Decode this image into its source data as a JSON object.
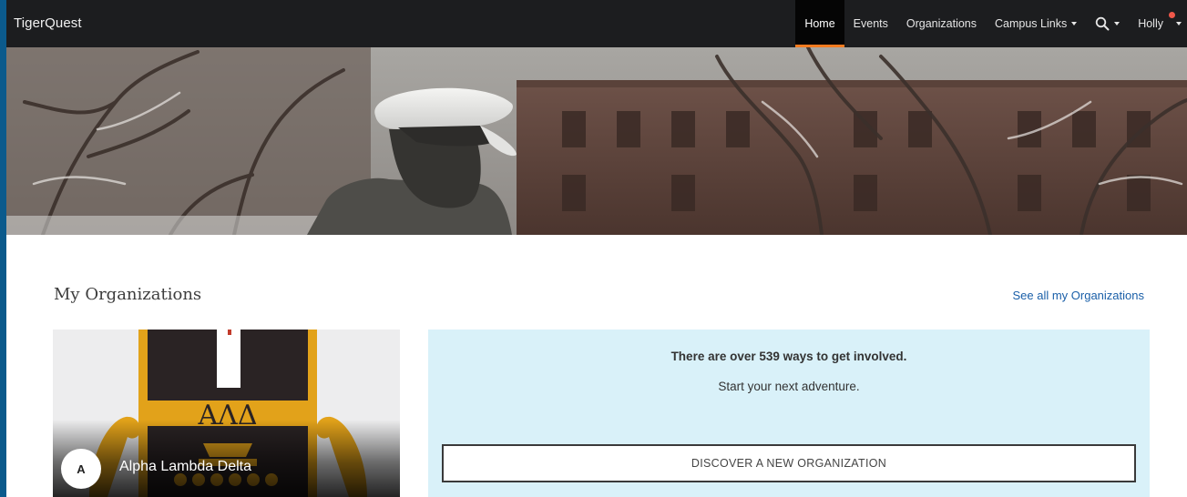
{
  "nav": {
    "brand": "TigerQuest",
    "items": [
      {
        "label": "Home",
        "active": true,
        "dropdown": false
      },
      {
        "label": "Events",
        "active": false,
        "dropdown": false
      },
      {
        "label": "Organizations",
        "active": false,
        "dropdown": false
      },
      {
        "label": "Campus Links",
        "active": false,
        "dropdown": true
      }
    ],
    "search_icon": "search-icon",
    "user_name": "Holly",
    "accent_color": "#f47b20",
    "notification_color": "#f0584a"
  },
  "hero": {
    "image": "statue-in-snowy-campus-photo"
  },
  "my_organizations": {
    "title": "My Organizations",
    "see_all_link": "See all my Organizations",
    "cards": [
      {
        "avatar_letter": "A",
        "name": "Alpha Lambda Delta",
        "logo_letters": "ΑΛΔ"
      }
    ]
  },
  "get_involved": {
    "headline": "There are over 539 ways to get involved.",
    "subline": "Start your next adventure.",
    "button_label": "DISCOVER A NEW ORGANIZATION",
    "panel_color": "#d9f1f9"
  }
}
